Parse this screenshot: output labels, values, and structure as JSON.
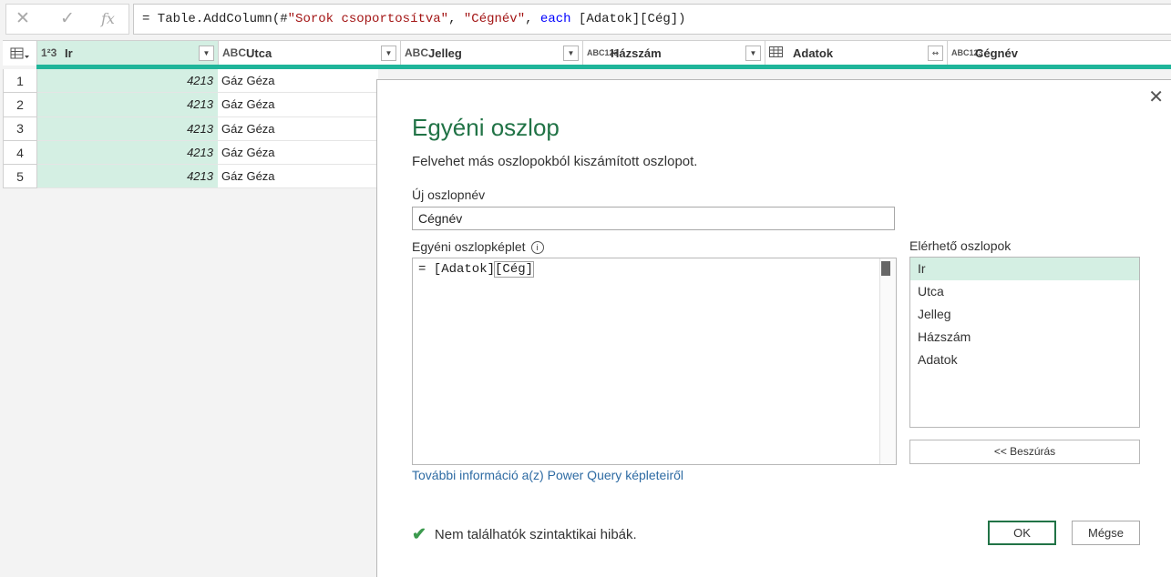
{
  "formula_bar": {
    "cancel_icon": "✕",
    "confirm_icon": "✓",
    "fx_icon": "fx",
    "formula_prefix": "= Table.AddColumn(#",
    "formula_str1": "\"Sorok csoportosítva\"",
    "formula_sep1": ", ",
    "formula_str2": "\"Cégnév\"",
    "formula_sep2": ", ",
    "formula_kw": "each",
    "formula_rest": " [Adatok][Cég])"
  },
  "grid": {
    "columns": [
      {
        "type": "1²3",
        "name": "Ir"
      },
      {
        "type": "ABC",
        "name": "Utca"
      },
      {
        "type": "ABC",
        "name": "Jelleg"
      },
      {
        "type": "ABC123",
        "name": "Házszám"
      },
      {
        "type": "table",
        "name": "Adatok"
      },
      {
        "type": "ABC123",
        "name": "Cégnév"
      }
    ],
    "rows": [
      {
        "n": "1",
        "ir": "4213",
        "utca": "Gáz Géza"
      },
      {
        "n": "2",
        "ir": "4213",
        "utca": "Gáz Géza"
      },
      {
        "n": "3",
        "ir": "4213",
        "utca": "Gáz Géza"
      },
      {
        "n": "4",
        "ir": "4213",
        "utca": "Gáz Géza"
      },
      {
        "n": "5",
        "ir": "4213",
        "utca": "Gáz Géza"
      }
    ]
  },
  "dialog": {
    "title": "Egyéni oszlop",
    "subtitle": "Felvehet más oszlopokból kiszámított oszlopot.",
    "name_label": "Új oszlopnév",
    "name_value": "Cégnév",
    "formula_label": "Egyéni oszlopképlet",
    "formula_text_a": "= [Adatok]",
    "formula_text_b": "[Cég]",
    "available_label": "Elérhető oszlopok",
    "available_columns": [
      "Ir",
      "Utca",
      "Jelleg",
      "Házszám",
      "Adatok"
    ],
    "insert_label": "<< Beszúrás",
    "link_text": "További információ a(z) Power Query képleteiről",
    "status_text": "Nem találhatók szintaktikai hibák.",
    "ok_label": "OK",
    "cancel_label": "Mégse"
  },
  "colors": {
    "accent": "#217346",
    "teal": "#1fb59a",
    "selection": "#d4efe3",
    "link": "#2e6ba3"
  }
}
